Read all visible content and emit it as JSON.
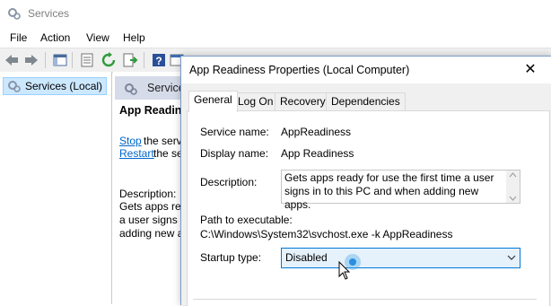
{
  "window": {
    "title": "Services"
  },
  "menu": [
    "File",
    "Action",
    "View",
    "Help"
  ],
  "tree": {
    "selected_label": "Services (Local)"
  },
  "services_header": {
    "label": "Services (Local)"
  },
  "detail": {
    "title": "App Readiness",
    "stop_link": "Stop",
    "stop_rest": "the service",
    "restart_link": "Restart",
    "restart_rest": "the service",
    "description_label": "Description:",
    "description_lines": [
      "Gets apps ready for use",
      "a user signs in to this PC",
      "adding new apps."
    ],
    "side_letters": [
      "S",
      "R",
      "R",
      "R",
      "R",
      "R",
      "R"
    ]
  },
  "dialog": {
    "title": "App Readiness Properties (Local Computer)",
    "close_glyph": "✕",
    "tabs": [
      "General",
      "Log On",
      "Recovery",
      "Dependencies"
    ],
    "service_name_label": "Service name:",
    "service_name": "AppReadiness",
    "display_name_label": "Display name:",
    "display_name": "App Readiness",
    "description_label": "Description:",
    "description": "Gets apps ready for use the first time a user signs in to this PC and when adding new apps.",
    "path_label": "Path to executable:",
    "path": "C:\\Windows\\System32\\svchost.exe -k AppReadiness",
    "startup_label": "Startup type:",
    "startup_value": "Disabled"
  }
}
